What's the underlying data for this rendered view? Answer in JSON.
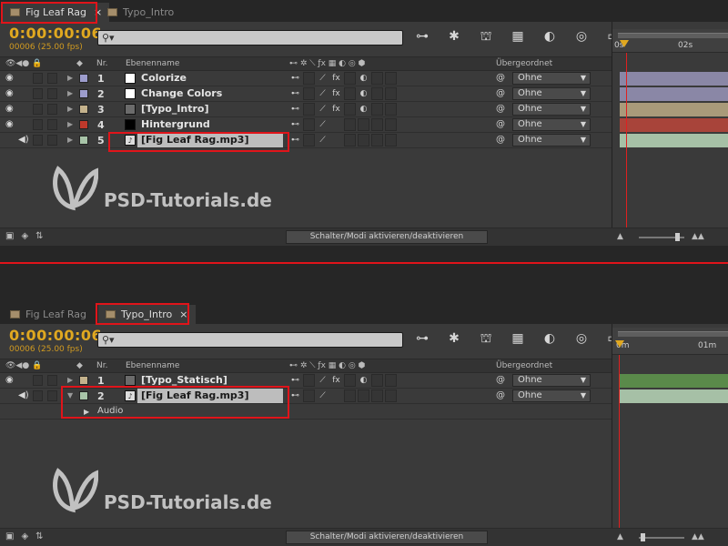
{
  "top": {
    "tabs": [
      {
        "label": "Fig Leaf Rag",
        "active": true,
        "close": "×"
      },
      {
        "label": "Typo_Intro",
        "active": false
      }
    ],
    "timecode": "0:00:00:06",
    "fps": "00006 (25.00 fps)",
    "search": {
      "value": "",
      "icon": "search-icon"
    },
    "columns": {
      "nr": "Nr.",
      "name": "Ebenenname",
      "parent": "Übergeordnet"
    },
    "layers": [
      {
        "num": "1",
        "name": "Colorize",
        "label_color": "#9c9ccc",
        "type_color": "#ffffff",
        "fx": "fx",
        "parent": "Ohne",
        "bar_color": "#8a87a6"
      },
      {
        "num": "2",
        "name": "Change Colors",
        "label_color": "#9c9ccc",
        "type_color": "#ffffff",
        "fx": "fx",
        "parent": "Ohne",
        "bar_color": "#8a87a6"
      },
      {
        "num": "3",
        "name": "[Typo_Intro]",
        "label_color": "#c4b28c",
        "type_color": "#6b6b6b",
        "fx": "fx",
        "parent": "Ohne",
        "bar_color": "#a99a7a"
      },
      {
        "num": "4",
        "name": "Hintergrund",
        "label_color": "#c0392b",
        "type_color": "#000000",
        "fx": "",
        "parent": "Ohne",
        "bar_color": "#a8443a"
      },
      {
        "num": "5",
        "name": "[Fig Leaf Rag.mp3]",
        "label_color": "#a8c4a8",
        "type_color": "#ffffff",
        "fx": "",
        "parent": "Ohne",
        "bar_color": "#a6c0a6",
        "selected": true
      }
    ],
    "ruler": {
      "mark0": "0s",
      "mark1": "02s"
    },
    "toggle_label": "Schalter/Modi aktivieren/deaktivieren",
    "watermark": "PSD-Tutorials.de"
  },
  "bottom": {
    "tabs": [
      {
        "label": "Fig Leaf Rag",
        "active": false
      },
      {
        "label": "Typo_Intro",
        "active": true,
        "close": "×"
      }
    ],
    "timecode": "0:00:00:06",
    "fps": "00006 (25.00 fps)",
    "search": {
      "value": "",
      "icon": "search-icon"
    },
    "columns": {
      "nr": "Nr.",
      "name": "Ebenenname",
      "parent": "Übergeordnet"
    },
    "layers": [
      {
        "num": "1",
        "name": "[Typo_Statisch]",
        "label_color": "#c4b28c",
        "type_color": "#6b6b6b",
        "fx": "fx",
        "parent": "Ohne",
        "bar_color": "#5a8a4a"
      },
      {
        "num": "2",
        "name": "[Fig Leaf Rag.mp3]",
        "label_color": "#a8c4a8",
        "type_color": "#ffffff",
        "fx": "",
        "parent": "Ohne",
        "bar_color": "#a6c0a6",
        "selected": true
      }
    ],
    "sub_property": "Audio",
    "ruler": {
      "mark0": "0m",
      "mark1": "01m"
    },
    "toggle_label": "Schalter/Modi aktivieren/deaktivieren",
    "watermark": "PSD-Tutorials.de"
  },
  "colors": {
    "highlight": "#e0141a",
    "timecode": "#e0a820"
  }
}
